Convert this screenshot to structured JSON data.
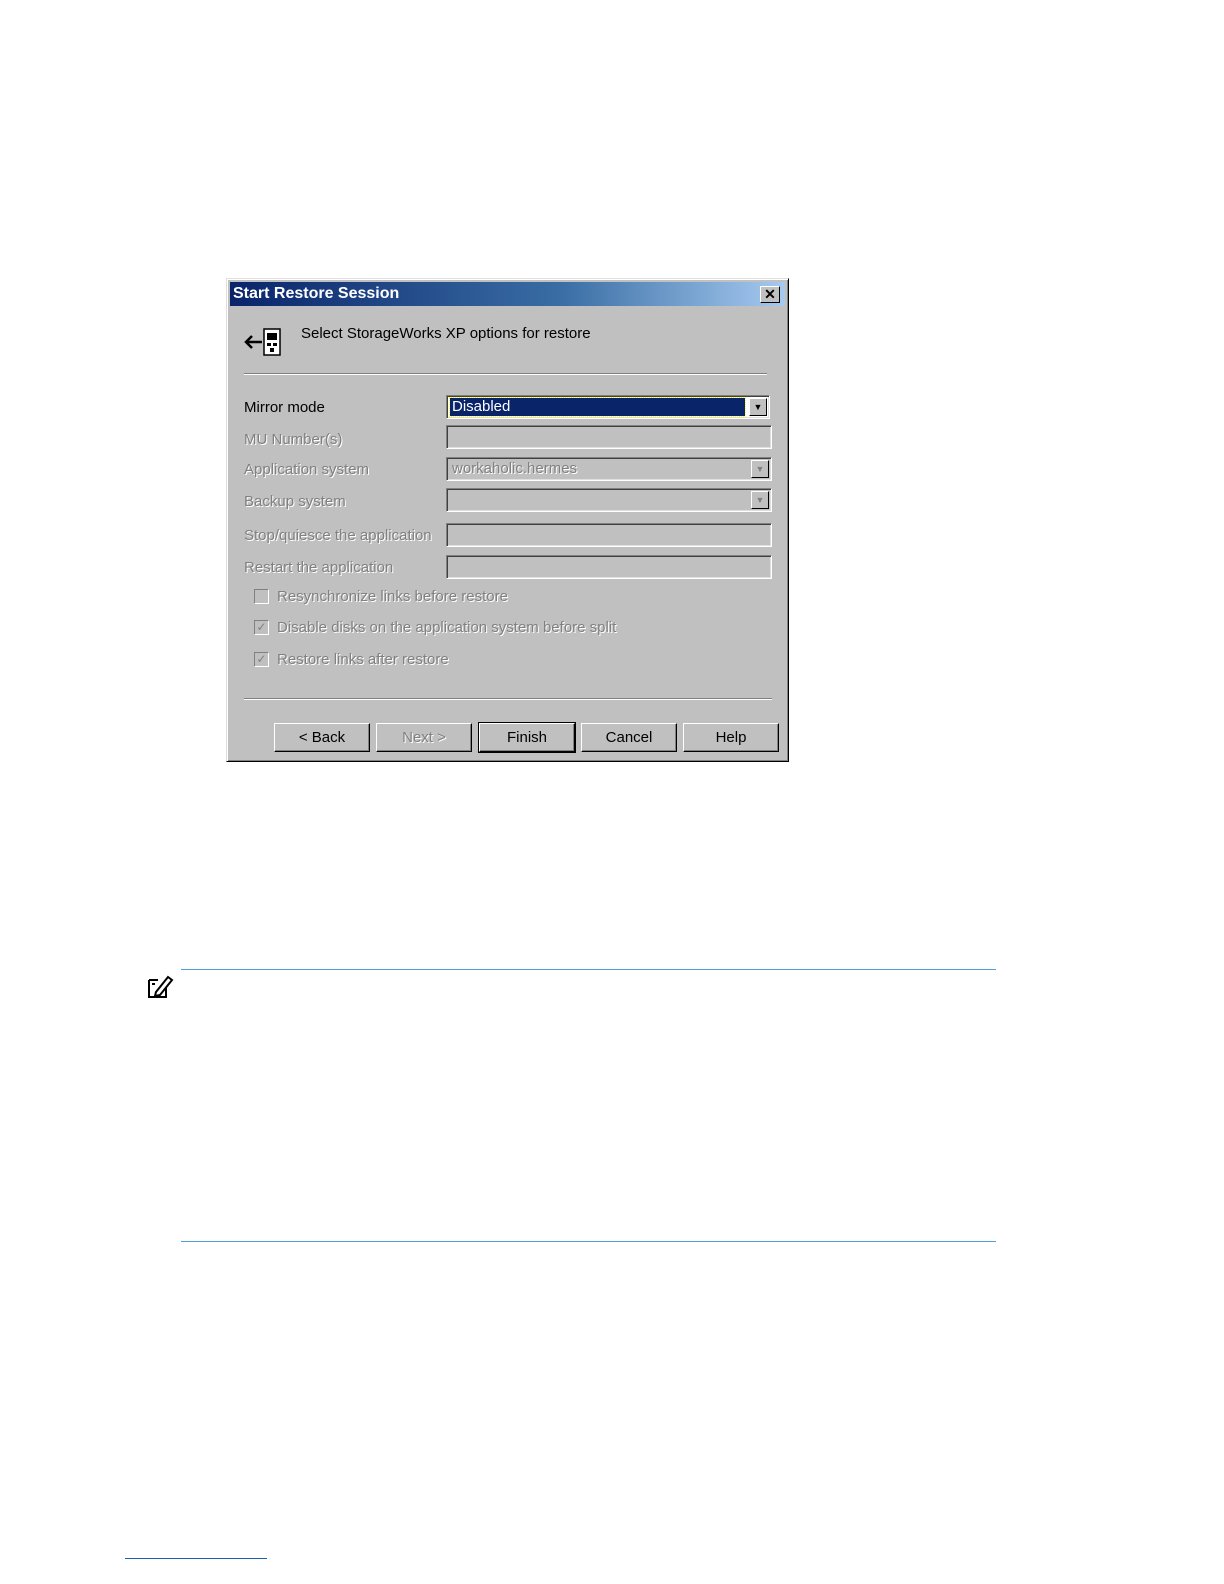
{
  "dialog": {
    "title": "Start Restore Session",
    "close_glyph": "✕",
    "header_icon": "restore-arrow-icon",
    "header_text": "Select StorageWorks XP options for restore"
  },
  "form": {
    "mirror_mode": {
      "label": "Mirror mode",
      "value": "Disabled"
    },
    "mu_numbers": {
      "label": "MU Number(s)",
      "value": ""
    },
    "application_system": {
      "label": "Application system",
      "value": "workaholic.hermes"
    },
    "backup_system": {
      "label": "Backup system",
      "value": ""
    },
    "stop_quiesce": {
      "label": "Stop/quiesce the application",
      "value": ""
    },
    "restart_app": {
      "label": "Restart the application",
      "value": ""
    }
  },
  "checkboxes": [
    {
      "label": "Resynchronize links before restore",
      "checked": false
    },
    {
      "label": "Disable disks on the application system before split",
      "checked": true
    },
    {
      "label": "Restore links after restore",
      "checked": true
    }
  ],
  "buttons": {
    "back": "< Back",
    "next": "Next >",
    "finish": "Finish",
    "cancel": "Cancel",
    "help": "Help"
  },
  "page": {
    "important_icon": "important-note-icon"
  },
  "colors": {
    "dialog_bg": "#c0c0c0",
    "title_start": "#0a246a",
    "title_end": "#a6caf0",
    "rule": "#4aa3d2"
  }
}
